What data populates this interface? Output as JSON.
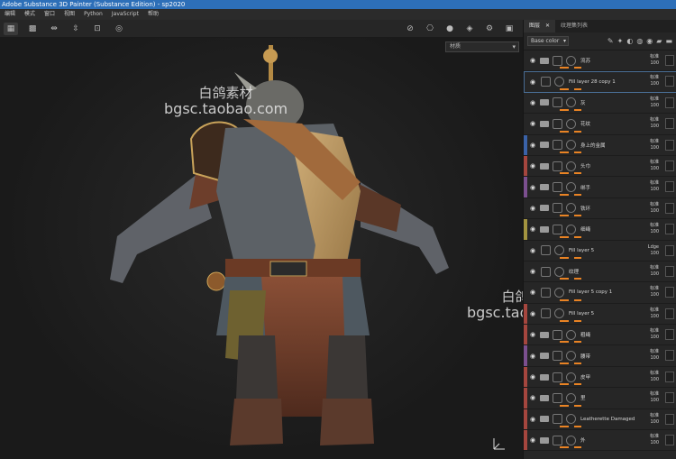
{
  "window": {
    "title": "Adobe Substance 3D Painter (Substance Edition) - sp2020"
  },
  "menu": [
    "编辑",
    "模式",
    "窗口",
    "视图",
    "Python",
    "JavaScript",
    "帮助"
  ],
  "viewport": {
    "dropdown_value": "材质",
    "watermark1": {
      "line1": "白鸽素材",
      "line2": "bgsc.taobao.com"
    },
    "watermark2": {
      "line1": "白鸽素材",
      "line2": "bgsc.taobao.com"
    }
  },
  "panel": {
    "tabs": [
      "图层",
      "纹理集列表"
    ],
    "channel": "Base color",
    "layers": [
      {
        "name": "流苏",
        "blend": "标准",
        "opacity": "100",
        "color": "#262626",
        "type": "folder"
      },
      {
        "name": "Fill layer 28 copy 1",
        "blend": "标准",
        "opacity": "100",
        "color": "#262626",
        "type": "fill",
        "selected": true
      },
      {
        "name": "灰",
        "blend": "标准",
        "opacity": "100",
        "color": "#262626",
        "type": "folder"
      },
      {
        "name": "花纹",
        "blend": "标准",
        "opacity": "100",
        "color": "#262626",
        "type": "folder"
      },
      {
        "name": "身上的金属",
        "blend": "标准",
        "opacity": "100",
        "color": "#3a62a8",
        "type": "folder"
      },
      {
        "name": "头巾",
        "blend": "标准",
        "opacity": "100",
        "color": "#a5463e",
        "type": "folder"
      },
      {
        "name": "绑手",
        "blend": "标准",
        "opacity": "100",
        "color": "#7b4f8f",
        "type": "folder"
      },
      {
        "name": "铁环",
        "blend": "标准",
        "opacity": "100",
        "color": "#262626",
        "type": "folder"
      },
      {
        "name": "细绳",
        "blend": "标准",
        "opacity": "100",
        "color": "#a39440",
        "type": "folder"
      },
      {
        "name": "Fill layer 5",
        "blend": "Ldge",
        "opacity": "100",
        "color": "#262626",
        "type": "fill"
      },
      {
        "name": "纹理",
        "blend": "标准",
        "opacity": "100",
        "color": "#262626",
        "type": "fill"
      },
      {
        "name": "Fill layer 5 copy 1",
        "blend": "标准",
        "opacity": "100",
        "color": "#262626",
        "type": "fill"
      },
      {
        "name": "Fill layer 5",
        "blend": "标准",
        "opacity": "100",
        "color": "#a5463e",
        "type": "fill"
      },
      {
        "name": "粗绳",
        "blend": "标准",
        "opacity": "100",
        "color": "#a5463e",
        "type": "folder"
      },
      {
        "name": "腰带",
        "blend": "标准",
        "opacity": "100",
        "color": "#7b4f8f",
        "type": "folder"
      },
      {
        "name": "皮甲",
        "blend": "标准",
        "opacity": "100",
        "color": "#a5463e",
        "type": "folder"
      },
      {
        "name": "里",
        "blend": "标准",
        "opacity": "100",
        "color": "#a5463e",
        "type": "folder"
      },
      {
        "name": "Leatherette Damaged",
        "blend": "标准",
        "opacity": "100",
        "color": "#a5463e",
        "type": "folder"
      },
      {
        "name": "外",
        "blend": "标准",
        "opacity": "100",
        "color": "#a5463e",
        "type": "folder"
      }
    ]
  }
}
